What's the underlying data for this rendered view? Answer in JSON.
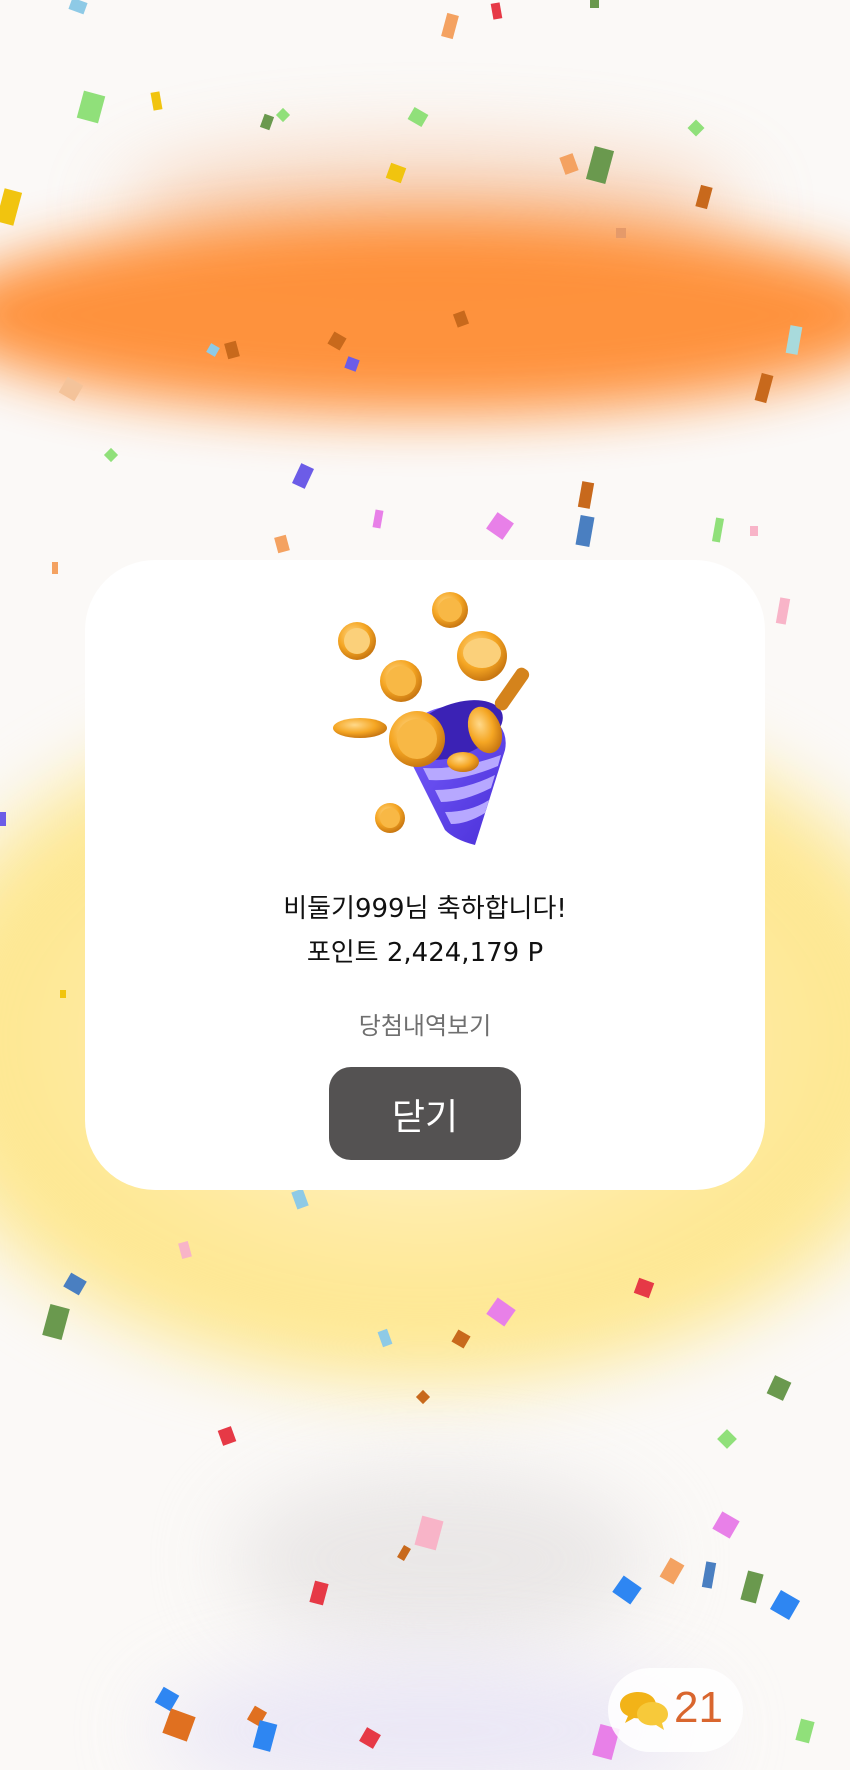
{
  "modal": {
    "congrats_text": "비둘기999님 축하합니다!",
    "points_text": "포인트 2,424,179 P",
    "history_link_label": "당첨내역보기",
    "close_button_label": "닫기",
    "illustration": "party-popper-coins-icon"
  },
  "chat": {
    "icon": "chat-bubbles-icon",
    "count": "21"
  },
  "colors": {
    "background_orange": "#ff8a2e",
    "background_yellow": "#fde78f",
    "close_button": "#545252",
    "chat_count": "#d9662e",
    "popper_purple": "#6a4df0",
    "coin_gold": "#f5a623"
  }
}
